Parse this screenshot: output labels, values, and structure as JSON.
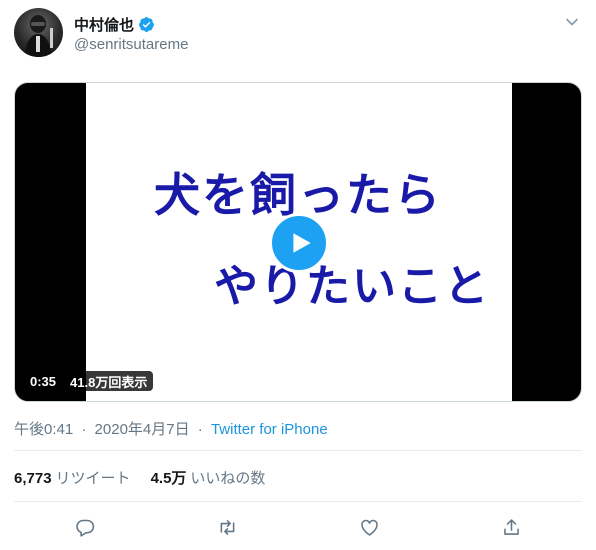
{
  "tweet": {
    "author": {
      "display_name": "中村倫也",
      "handle": "@senritsutareme",
      "verified": true
    },
    "media": {
      "video_title_line1": "犬を飼ったら",
      "video_title_line2": "やりたいこと",
      "duration": "0:35",
      "views": "41.8万回表示"
    },
    "time": "午後0:41",
    "date": "2020年4月7日",
    "source": "Twitter for iPhone",
    "stats": {
      "retweets_count": "6,773",
      "retweets_label": "リツイート",
      "likes_count": "4.5万",
      "likes_label": "いいねの数"
    },
    "actions": [
      "reply-icon",
      "retweet-icon",
      "like-icon",
      "share-icon"
    ]
  },
  "colors": {
    "accent": "#1da1f2",
    "link": "#1b95e0",
    "muted": "#657786",
    "video_text": "#1a1aa8"
  }
}
